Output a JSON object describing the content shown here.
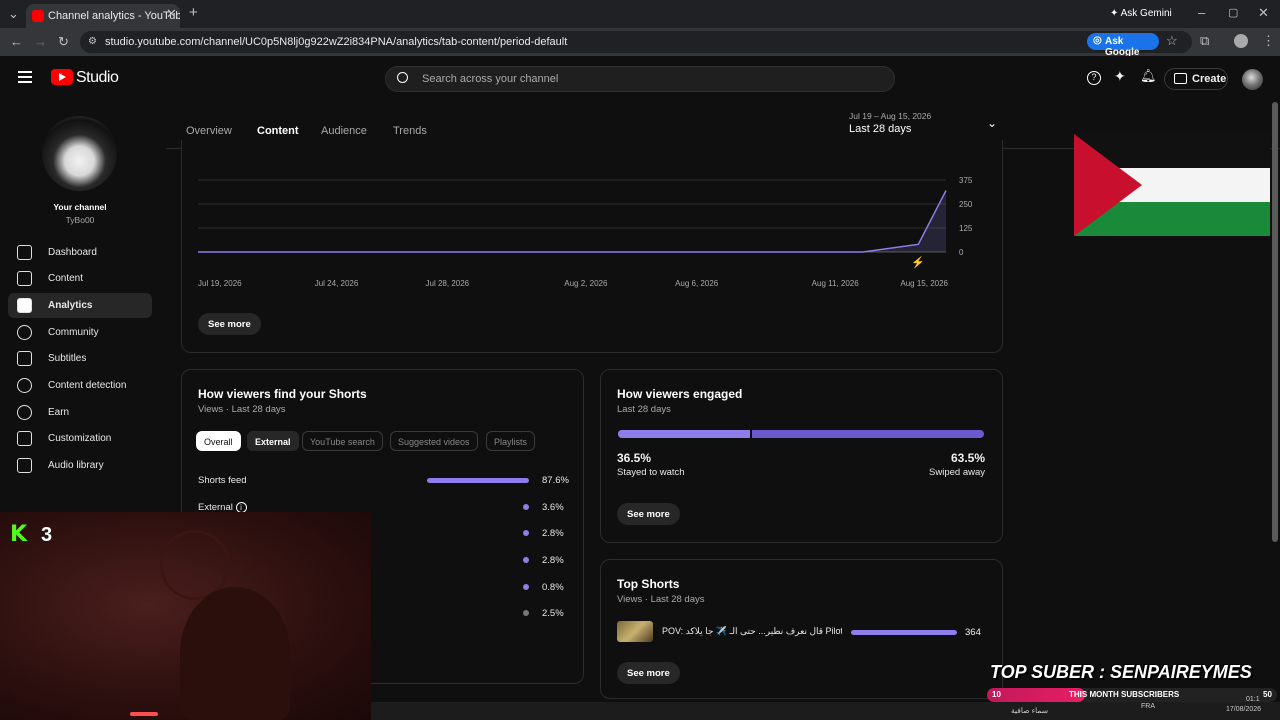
{
  "browser": {
    "tab_title": "Channel analytics - YouTube Stu",
    "ask_gemini": "Ask Gemini",
    "url": "studio.youtube.com/channel/UC0p5N8lj0g922wZ2i834PNA/analytics/tab-content/period-default",
    "ask_google": "Ask Google"
  },
  "header": {
    "logo_text": "Studio",
    "search_placeholder": "Search across your channel",
    "create_label": "Create"
  },
  "sidebar": {
    "channel_label": "Your channel",
    "channel_name": "TyBo00",
    "items": [
      {
        "label": "Dashboard",
        "icon": "dashboard-icon"
      },
      {
        "label": "Content",
        "icon": "content-icon"
      },
      {
        "label": "Analytics",
        "icon": "analytics-icon",
        "active": true
      },
      {
        "label": "Community",
        "icon": "community-icon"
      },
      {
        "label": "Subtitles",
        "icon": "subtitles-icon"
      },
      {
        "label": "Content detection",
        "icon": "copyright-icon"
      },
      {
        "label": "Earn",
        "icon": "dollar-icon"
      },
      {
        "label": "Customization",
        "icon": "customization-icon"
      },
      {
        "label": "Audio library",
        "icon": "audio-library-icon"
      }
    ]
  },
  "tabs": [
    "Overview",
    "Content",
    "Audience",
    "Trends"
  ],
  "active_tab": "Content",
  "period": {
    "range": "Jul 19 – Aug 15, 2026",
    "label": "Last 28 days"
  },
  "chart_data": {
    "type": "line",
    "x": [
      "Jul 19, 2026",
      "Jul 24, 2026",
      "Jul 28, 2026",
      "Aug 2, 2026",
      "Aug 6, 2026",
      "Aug 11, 2026",
      "Aug 15, 2026"
    ],
    "x_ticks": [
      "Jul 19, 2026",
      "Jul 24, 2026",
      "Jul 28, 2026",
      "Aug 2, 2026",
      "Aug 6, 2026",
      "Aug 11, 2026",
      "Aug 15, 2026"
    ],
    "y_ticks": [
      "375",
      "250",
      "125",
      "0"
    ],
    "ylim": [
      0,
      375
    ],
    "points": [
      {
        "date": "Jul 19",
        "value": 0
      },
      {
        "date": "Aug 12",
        "value": 0
      },
      {
        "date": "Aug 14",
        "value": 40
      },
      {
        "date": "Aug 15",
        "value": 320
      }
    ],
    "color": "#8d7dea",
    "grid": true
  },
  "see_more": "See more",
  "find_shorts": {
    "title": "How viewers find your Shorts",
    "subtitle": "Views · Last 28 days",
    "chips": [
      "Overall",
      "External",
      "YouTube search",
      "Suggested videos",
      "Playlists"
    ],
    "rows": [
      {
        "label": "Shorts feed",
        "value": "87.6%",
        "fraction": 0.876
      },
      {
        "label": "External",
        "value": "3.6%",
        "fraction": 0.036
      },
      {
        "label": "",
        "value": "2.8%",
        "fraction": 0.028
      },
      {
        "label": "",
        "value": "2.8%",
        "fraction": 0.028
      },
      {
        "label": "",
        "value": "0.8%",
        "fraction": 0.008
      },
      {
        "label": "",
        "value": "2.5%",
        "fraction": 0.025
      }
    ]
  },
  "engaged": {
    "title": "How viewers engaged",
    "subtitle": "Last 28 days",
    "stayed_pct": "36.5%",
    "stayed_label": "Stayed to watch",
    "stayed_fraction": 0.365,
    "swiped_pct": "63.5%",
    "swiped_label": "Swiped away"
  },
  "top_shorts": {
    "title": "Top Shorts",
    "subtitle": "Views · Last 28 days",
    "item_title": "POV: قال نعرف نطير... حتى الـ ✈️ جا يلاكد Pilot...",
    "item_views": "364"
  },
  "overlay": {
    "kick_count": "3",
    "top_suber": "TOP SUBER : SENPAIREYMES",
    "sub_left": "10",
    "sub_label": "THIS MONTH SUBSCRIBERS",
    "sub_right": "50",
    "sub_fraction": 0.2,
    "clock_time": "01:1",
    "clock_date": "17/08/2026",
    "lang": "FRA",
    "weather": "سماء صافية"
  }
}
